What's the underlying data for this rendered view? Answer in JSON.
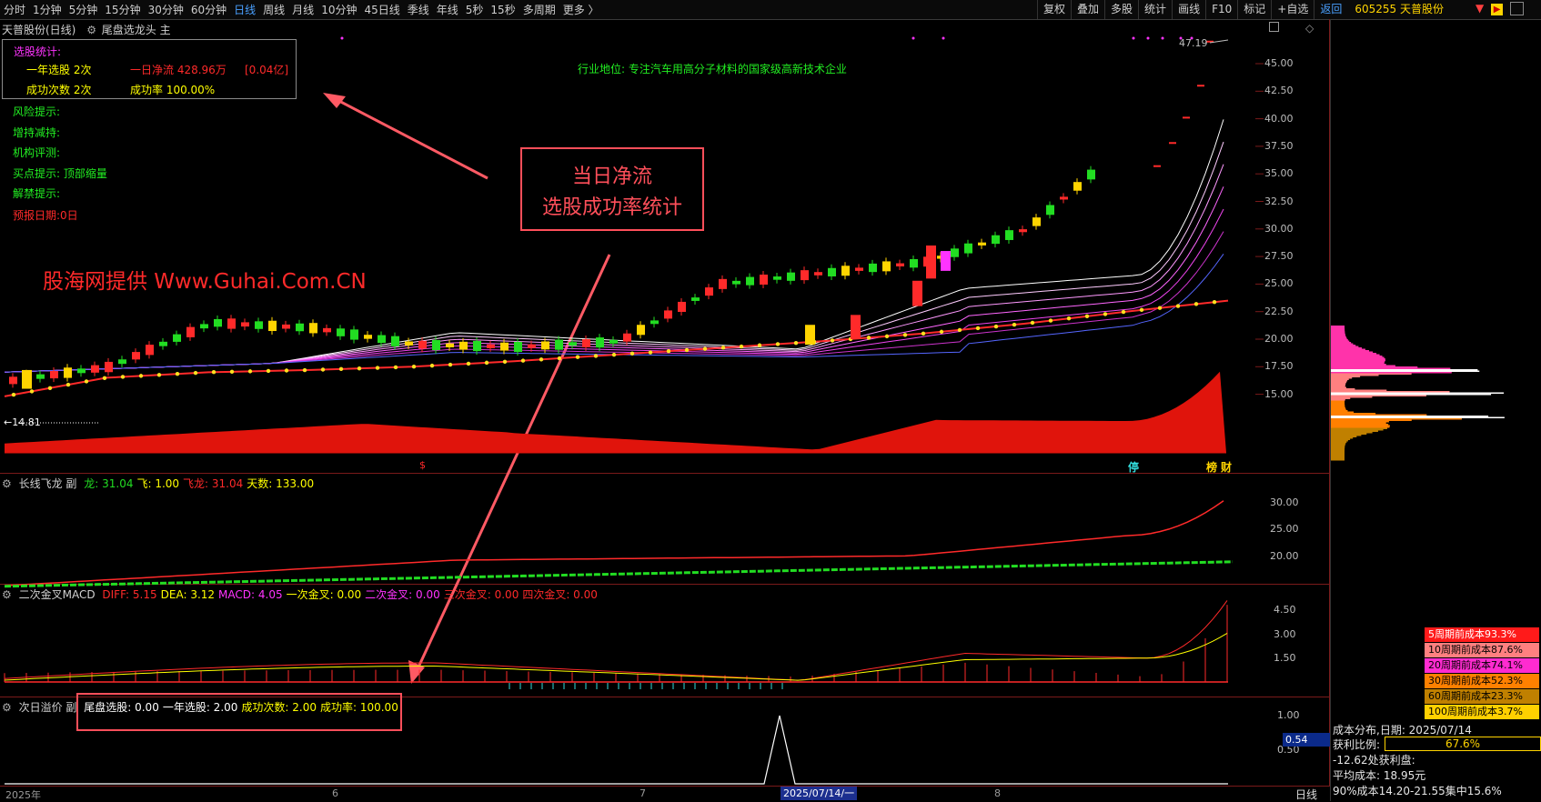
{
  "toolbar": {
    "periods": [
      "分时",
      "1分钟",
      "5分钟",
      "15分钟",
      "30分钟",
      "60分钟",
      "日线",
      "周线",
      "月线",
      "10分钟",
      "45日线",
      "季线",
      "年线",
      "5秒",
      "15秒",
      "多周期",
      "更多 〉"
    ],
    "active_period": "日线",
    "buttons": [
      "复权",
      "叠加",
      "多股",
      "统计",
      "画线",
      "F10",
      "标记",
      "+自选"
    ],
    "back": "返回",
    "symbol": "605255 天普股份"
  },
  "main_panel": {
    "title": "天普股份(日线)",
    "indicator": "尾盘选龙头 主",
    "price_ticks": [
      "45.00",
      "42.50",
      "40.00",
      "37.50",
      "35.00",
      "32.50",
      "30.00",
      "27.50",
      "25.00",
      "22.50",
      "20.00",
      "17.50",
      "15.00"
    ],
    "stats": {
      "header": "选股统计:",
      "row1_left": "一年选股 2次",
      "row1_mid": "一日净流 428.96万",
      "row1_right": "[0.04亿]",
      "row2_left": "成功次数 2次",
      "row2_mid": "成功率 100.00%"
    },
    "side_labels": [
      "风险提示:",
      "增持减持:",
      "机构评测:",
      "买点提示: 顶部缩量",
      "解禁提示:"
    ],
    "report_date": "预报日期:0日",
    "industry": "行业地位: 专注汽车用高分子材料的国家级高新技术企业",
    "watermark": "股海网提供 Www.Guhai.Com.CN",
    "high_label": "47.19",
    "low_label": "14.81",
    "bottom_marks": [
      "停",
      "榜",
      "财"
    ],
    "dollar_mark": "$"
  },
  "annotation": {
    "line1": "当日净流",
    "line2": "选股成功率统计"
  },
  "panel2": {
    "title": "长线飞龙 副",
    "values": [
      {
        "label": "龙: 31.04",
        "color": "#22dd22"
      },
      {
        "label": "飞: 1.00",
        "color": "#ffff00"
      },
      {
        "label": "飞龙: 31.04",
        "color": "#ff2a2a"
      },
      {
        "label": "天数: 133.00",
        "color": "#ffff00"
      }
    ],
    "ticks": [
      "30.00",
      "25.00",
      "20.00"
    ]
  },
  "panel3": {
    "title": "二次金叉MACD",
    "values": [
      {
        "label": "DIFF: 5.15",
        "color": "#ff2a2a"
      },
      {
        "label": "DEA: 3.12",
        "color": "#ffff00"
      },
      {
        "label": "MACD: 4.05",
        "color": "#ff33ff"
      },
      {
        "label": "一次金叉: 0.00",
        "color": "#ffff00"
      },
      {
        "label": "二次金叉: 0.00",
        "color": "#ff33ff"
      },
      {
        "label": "三次金叉: 0.00",
        "color": "#ff2a2a"
      },
      {
        "label": "四次金叉: 0.00",
        "color": "#ff2a2a"
      }
    ],
    "ticks": [
      "4.50",
      "3.00",
      "1.50"
    ]
  },
  "panel4": {
    "title": "次日溢价 副",
    "values": [
      {
        "label": "尾盘选股: 0.00",
        "color": "#ffffff"
      },
      {
        "label": "一年选股: 2.00",
        "color": "#ffffff"
      },
      {
        "label": "成功次数: 2.00",
        "color": "#ffff00"
      },
      {
        "label": "成功率: 100.00",
        "color": "#ffff00"
      }
    ],
    "ticks": [
      "1.00",
      "0.50"
    ],
    "current_value": "0.54"
  },
  "date_axis": {
    "labels": [
      "2025年",
      "6",
      "7",
      "8"
    ],
    "cursor_date": "2025/07/14/一",
    "period_label": "日线"
  },
  "cost_legend": [
    {
      "label": "5周期前成本93.3%",
      "bg": "#ff1a1a",
      "fg": "#ffffff"
    },
    {
      "label": "10周期前成本87.6%",
      "bg": "#ff8080",
      "fg": "#000000"
    },
    {
      "label": "20周期前成本74.1%",
      "bg": "#ff2bd0",
      "fg": "#000000"
    },
    {
      "label": "30周期前成本52.3%",
      "bg": "#ff8000",
      "fg": "#000000"
    },
    {
      "label": "60周期前成本23.3%",
      "bg": "#c08000",
      "fg": "#000000"
    },
    {
      "label": "100周期前成本3.7%",
      "bg": "#ffd000",
      "fg": "#000000"
    }
  ],
  "cost_info": {
    "title": "成本分布,日期: 2025/07/14",
    "profit_label": "获利比例:",
    "profit_value": "67.6%",
    "profit_fraction": 0.676,
    "profit_line": "-12.62处获利盘:",
    "avg_cost": "平均成本: 18.95元",
    "range90": "90%成本14.20-21.55集中15.6%"
  },
  "colors": {
    "up": "#ff2a2a",
    "down": "#22dd22",
    "grid": "#7a1a1a",
    "accent": "#4aa0ff",
    "stats_red": "#ff2a2a",
    "label_green": "#22ee22"
  },
  "chart_data": {
    "type": "line",
    "title": "天普股份(日线)",
    "xlabel": "",
    "ylabel": "",
    "ylim": [
      12.5,
      47.5
    ],
    "x": [
      "2025年",
      "6",
      "7",
      "8"
    ],
    "series": [
      {
        "name": "",
        "values": [
          14.81,
          16.5,
          17.0,
          17.2,
          17.5,
          18.0,
          18.6,
          19.2,
          19.8,
          20.5,
          21.4,
          22.5,
          23.5
        ]
      },
      {
        "name": "",
        "values": [
          16.2,
          17.5,
          21.5,
          21.0,
          19.5,
          19.3,
          19.8,
          25.0,
          26.0,
          27.0,
          30.0,
          38.0,
          47.19
        ]
      }
    ]
  }
}
